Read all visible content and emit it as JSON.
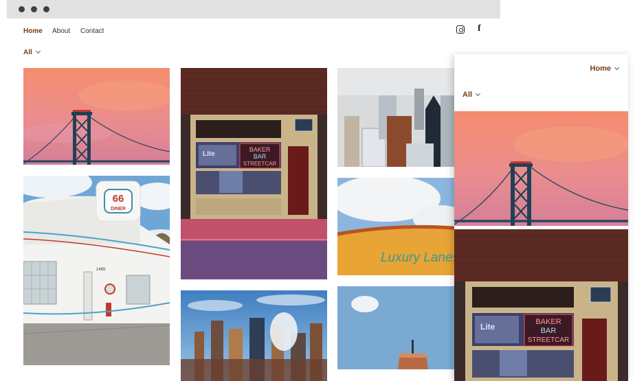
{
  "nav": {
    "items": [
      {
        "label": "Home",
        "active": true
      },
      {
        "label": "About",
        "active": false
      },
      {
        "label": "Contact",
        "active": false
      }
    ],
    "social": [
      "instagram-icon",
      "facebook-icon"
    ],
    "facebook_glyph": "f"
  },
  "filter": {
    "label": "All"
  },
  "gallery": {
    "photos": [
      {
        "name": "bridge-sunset-photo",
        "subject": "suspension bridge tower at pink sunset"
      },
      {
        "name": "diner-photo",
        "subject": "white art deco diner with 66 Diner sign",
        "sign": "66",
        "sign_sub": "DINER",
        "address": "1465"
      },
      {
        "name": "baker-bar-photo",
        "subject": "brick storefront with neon sign",
        "neon": [
          "BAKER",
          "BAR",
          "STREETCAR"
        ],
        "beer_sign": "Lite"
      },
      {
        "name": "city-skyline-photo",
        "subject": "downtown skyline with steam"
      },
      {
        "name": "aerial-city-photo",
        "subject": "aerial view of downtown towers"
      },
      {
        "name": "luxury-lanes-photo",
        "subject": "yellow building with Luxury Lanes sign",
        "sign": "Luxury Lanes"
      },
      {
        "name": "tower-sky-photo",
        "subject": "tower top against blue sky"
      }
    ]
  },
  "mobile": {
    "nav_label": "Home",
    "filter_label": "All",
    "neon": [
      "BAKER",
      "BAR",
      "STREETCAR"
    ],
    "beer_sign": "Lite"
  },
  "colors": {
    "accent": "#7a3a12",
    "titlebar": "#e1e1e1"
  }
}
